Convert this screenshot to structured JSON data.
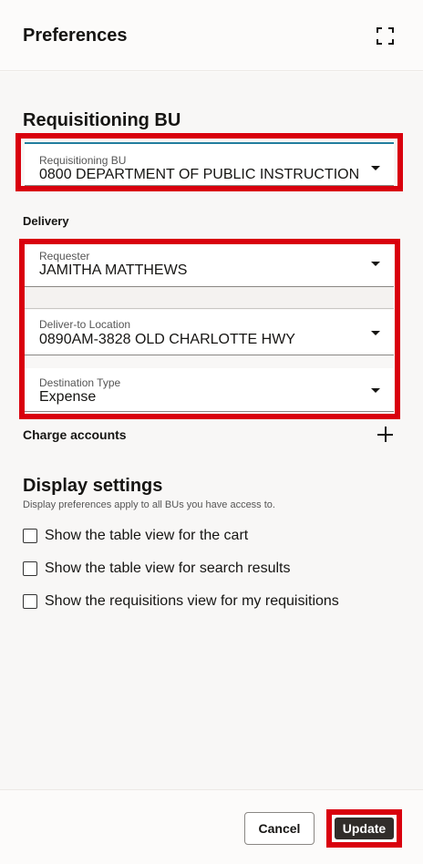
{
  "panel": {
    "title": "Preferences",
    "expand_icon": "expand-icon"
  },
  "requisitioning": {
    "heading": "Requisitioning BU",
    "field_label": "Requisitioning BU",
    "field_value": "0800 DEPARTMENT OF PUBLIC INSTRUCTION"
  },
  "delivery": {
    "heading": "Delivery",
    "requester_label": "Requester",
    "requester_value": "JAMITHA MATTHEWS",
    "location_label": "Deliver-to Location",
    "location_value": "0890AM-3828 OLD CHARLOTTE HWY",
    "destination_label": "Destination Type",
    "destination_value": "Expense"
  },
  "charge_accounts": {
    "label": "Charge accounts",
    "add_icon": "plus-icon"
  },
  "display": {
    "heading": "Display settings",
    "note": "Display preferences apply to all BUs you have access to.",
    "options": [
      {
        "label": "Show the table view for the cart",
        "checked": false
      },
      {
        "label": "Show the table view for search results",
        "checked": false
      },
      {
        "label": "Show the requisitions view for my requisitions",
        "checked": false
      }
    ]
  },
  "footer": {
    "cancel_label": "Cancel",
    "update_label": "Update"
  },
  "colors": {
    "highlight": "#d9000d",
    "primary_button": "#312d2a",
    "accent_focus": "#227e9e"
  }
}
